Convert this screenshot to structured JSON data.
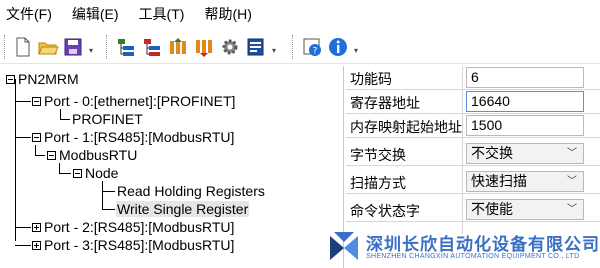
{
  "menu": {
    "file": "文件(F)",
    "edit": "编辑(E)",
    "tools": "工具(T)",
    "help": "帮助(H)"
  },
  "toolbar": {
    "icons": [
      "new-file-icon",
      "open-folder-icon",
      "save-icon",
      "add-device-icon",
      "delete-device-icon",
      "upload-config-icon",
      "download-config-icon",
      "settings-gear-icon",
      "export-icon",
      "config-help-icon",
      "info-icon"
    ]
  },
  "tree": {
    "root": "PN2MRM",
    "port0": "Port - 0:[ethernet]:[PROFINET]",
    "profinet": "PROFINET",
    "port1": "Port - 1:[RS485]:[ModbusRTU]",
    "modbusrtu": "ModbusRTU",
    "node": "Node",
    "read_holding": "Read Holding Registers",
    "write_single": "Write Single Register",
    "port2": "Port - 2:[RS485]:[ModbusRTU]",
    "port3": "Port - 3:[RS485]:[ModbusRTU]"
  },
  "properties": {
    "function_code_label": "功能码",
    "function_code_value": "6",
    "register_address_label": "寄存器地址",
    "register_address_value": "16640",
    "memory_map_label": "内存映射起始地址",
    "memory_map_value": "1500",
    "byte_swap_label": "字节交换",
    "byte_swap_value": "不交换",
    "scan_mode_label": "扫描方式",
    "scan_mode_value": "快速扫描",
    "command_status_label": "命令状态字",
    "command_status_value": "不使能"
  },
  "watermark": {
    "company_cn": "深圳长欣自动化设备有限公司",
    "company_en": "SHENZHEN CHANGXIN AUTOMATION EQUIPMENT CO., LTD",
    "brand_color": "#3a6fc6"
  }
}
